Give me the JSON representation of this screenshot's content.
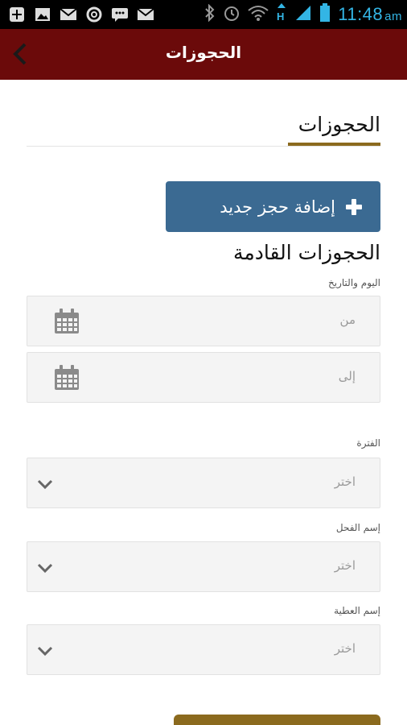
{
  "status_bar": {
    "time": "11:48",
    "ampm": "am",
    "left_icons": [
      "add-notification-icon",
      "image-icon",
      "mail-icon",
      "lifebuoy-icon",
      "chat-icon",
      "mail-icon"
    ],
    "right_icons": [
      "bluetooth-icon",
      "alarm-icon",
      "wifi-icon",
      "hspa-icon",
      "signal-icon",
      "battery-icon"
    ],
    "accent_color": "#33b5e5"
  },
  "app_bar": {
    "title": "الحجوزات",
    "background": "#6b0a0a"
  },
  "page": {
    "heading": "الحجوزات",
    "underline_color": "#8b6a1e"
  },
  "add_button": {
    "label": "إضافة حجز جديد",
    "icon": "plus-icon",
    "color": "#3b6a92"
  },
  "upcoming": {
    "title": "الحجوزات القادمة",
    "date_label": "اليوم والتاريخ",
    "from_placeholder": "من",
    "to_placeholder": "إلى",
    "period_label": "الفترة",
    "period_value": "اختر",
    "stallion_label": "إسم الفحل",
    "stallion_value": "اختر",
    "mare_label": "إسم العطية",
    "mare_value": "اختر"
  },
  "bottom_button_color": "#8b6a1e"
}
